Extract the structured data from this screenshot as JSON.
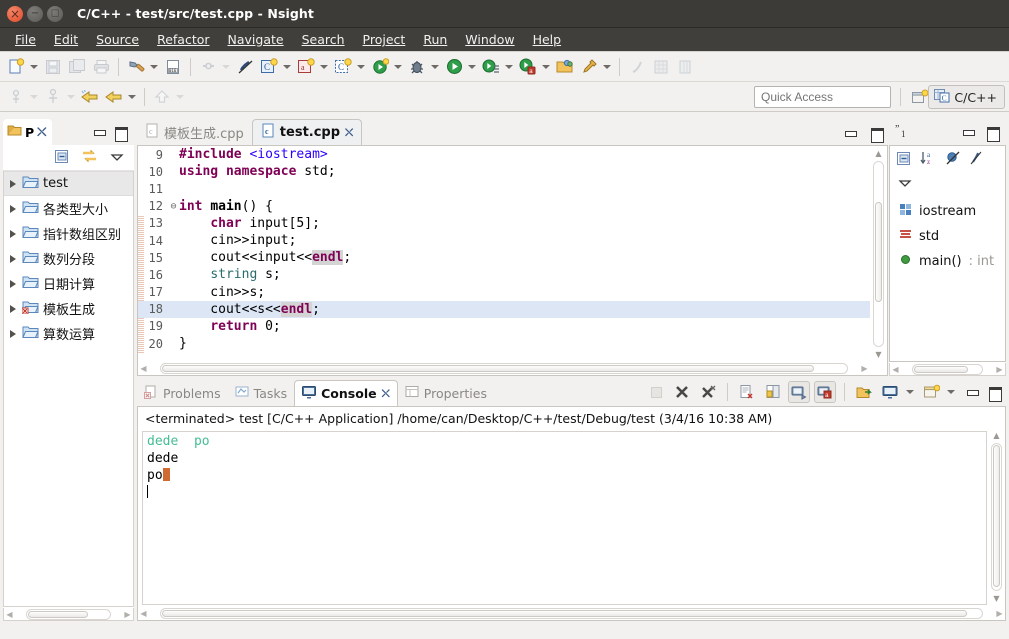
{
  "window": {
    "title": "C/C++ - test/src/test.cpp - Nsight",
    "controls": {
      "close": "close-window",
      "minimize": "minimize-window",
      "maximize": "maximize-window"
    }
  },
  "menubar": {
    "items": [
      {
        "label": "File"
      },
      {
        "label": "Edit"
      },
      {
        "label": "Source"
      },
      {
        "label": "Refactor"
      },
      {
        "label": "Navigate"
      },
      {
        "label": "Search"
      },
      {
        "label": "Project"
      },
      {
        "label": "Run"
      },
      {
        "label": "Window"
      },
      {
        "label": "Help"
      }
    ]
  },
  "toolbar": {
    "quick_access_placeholder": "Quick Access",
    "perspective_label": "C/C++",
    "icons": [
      "new-file-icon",
      "save-icon",
      "save-all-icon",
      "print-icon",
      "build-hammer-icon",
      "build-config-icon",
      "link-break-icon",
      "no-link-icon",
      "new-c-project-icon",
      "new-c-class-icon",
      "new-c-source-icon",
      "run-last-icon",
      "debug-icon",
      "run-icon",
      "run-as-icon",
      "debug-as-icon",
      "open-folder-icon",
      "pin-icon",
      "sketch-icon",
      "table-icon",
      "column-icon"
    ],
    "nav_icons": [
      "toggle-mark-occurrences-icon",
      "annotation-icon",
      "back-history-icon",
      "forward-history-icon",
      "up-icon"
    ],
    "open_perspective_icon": "open-perspective-icon"
  },
  "project_explorer": {
    "tab_label": "P",
    "tab_icon": "project-explorer-icon",
    "tab_close_icon": "close-tab-icon",
    "tools": [
      "collapse-all-icon",
      "link-with-editor-icon",
      "view-menu-icon"
    ],
    "minimize_icon": "minimize-view-icon",
    "maximize_icon": "maximize-view-icon",
    "items": [
      {
        "label": "test",
        "icon": "c-project-icon",
        "selected": true,
        "error": false
      },
      {
        "label": "各类型大小",
        "icon": "c-project-icon",
        "selected": false,
        "error": false
      },
      {
        "label": "指针数组区别",
        "icon": "c-project-icon",
        "selected": false,
        "error": false
      },
      {
        "label": "数列分段",
        "icon": "c-project-icon",
        "selected": false,
        "error": false
      },
      {
        "label": "日期计算",
        "icon": "c-project-icon",
        "selected": false,
        "error": false
      },
      {
        "label": "模板生成",
        "icon": "c-project-icon",
        "selected": false,
        "error": true
      },
      {
        "label": "算数运算",
        "icon": "c-project-icon",
        "selected": false,
        "error": false
      }
    ]
  },
  "editor": {
    "tabs": [
      {
        "label": "模板生成.cpp",
        "active": false,
        "icon": "cpp-file-icon",
        "closable": false
      },
      {
        "label": "test.cpp",
        "active": true,
        "icon": "cpp-file-icon",
        "closable": true,
        "close_icon": "close-tab-icon"
      }
    ],
    "minimize_icon": "minimize-view-icon",
    "maximize_icon": "maximize-view-icon",
    "first_line_number": 9,
    "current_line": 18,
    "lines": [
      {
        "n": 9,
        "fold": "",
        "text": "#include <iostream>"
      },
      {
        "n": 10,
        "fold": "",
        "text": "using namespace std;"
      },
      {
        "n": 11,
        "fold": "",
        "text": ""
      },
      {
        "n": 12,
        "fold": "-",
        "text": "int main() {"
      },
      {
        "n": 13,
        "fold": "",
        "text": "    char input[5];"
      },
      {
        "n": 14,
        "fold": "",
        "text": "    cin>>input;"
      },
      {
        "n": 15,
        "fold": "",
        "text": "    cout<<input<<endl;"
      },
      {
        "n": 16,
        "fold": "",
        "text": "    string s;"
      },
      {
        "n": 17,
        "fold": "",
        "text": "    cin>>s;"
      },
      {
        "n": 18,
        "fold": "",
        "text": "    cout<<s<<endl;"
      },
      {
        "n": 19,
        "fold": "",
        "text": "    return 0;"
      },
      {
        "n": 20,
        "fold": "",
        "text": "}"
      }
    ]
  },
  "outline": {
    "quote_icon": "quote-1-icon",
    "minimize_icon": "minimize-view-icon",
    "maximize_icon": "maximize-view-icon",
    "tools": [
      "collapse-all-icon",
      "sort-az-icon",
      "hide-fields-icon",
      "hide-static-icon",
      "view-menu-icon"
    ],
    "items": [
      {
        "label": "iostream",
        "icon": "include-icon",
        "rettype": ""
      },
      {
        "label": "std",
        "icon": "namespace-icon",
        "rettype": ""
      },
      {
        "label": "main()",
        "icon": "public-method-icon",
        "rettype": ": int"
      }
    ]
  },
  "console": {
    "tabs": [
      {
        "label": "Problems",
        "icon": "problems-icon",
        "active": false,
        "closable": false
      },
      {
        "label": "Tasks",
        "icon": "tasks-icon",
        "active": false,
        "closable": false
      },
      {
        "label": "Console",
        "icon": "console-icon",
        "active": true,
        "closable": true,
        "close_icon": "close-tab-icon"
      },
      {
        "label": "Properties",
        "icon": "properties-icon",
        "active": false,
        "closable": false
      }
    ],
    "tools": [
      "terminate-all-icon",
      "remove-launch-icon",
      "remove-all-terminated-icon",
      "clear-console-icon",
      "scroll-lock-icon",
      "show-console-on-output-icon",
      "pin-console-icon",
      "open-console-icon",
      "display-selected-console-icon",
      "new-console-view-icon"
    ],
    "minimize_icon": "minimize-view-icon",
    "maximize_icon": "maximize-view-icon",
    "header": "<terminated> test [C/C++ Application] /home/can/Desktop/C++/test/Debug/test (3/4/16 10:38 AM)",
    "output_lines": [
      {
        "text": "dede  po",
        "style": "echo"
      },
      {
        "text": "dede",
        "style": "normal"
      },
      {
        "text": "po",
        "style": "normal",
        "cursor": "block"
      },
      {
        "text": "",
        "style": "normal",
        "cursor": "caret"
      }
    ]
  },
  "colors": {
    "titlebar_bg": "#3c3b37",
    "menubar_bg": "#413f3b",
    "chrome_bg": "#f2f1f0",
    "keyword": "#7f0055",
    "string": "#2a00ff",
    "current_line": "#dce6f4",
    "occurrence": "#d4d4d4",
    "console_echo": "#45bd94",
    "cursor_block": "#cf6a33",
    "selection": "#e8e8e8"
  }
}
